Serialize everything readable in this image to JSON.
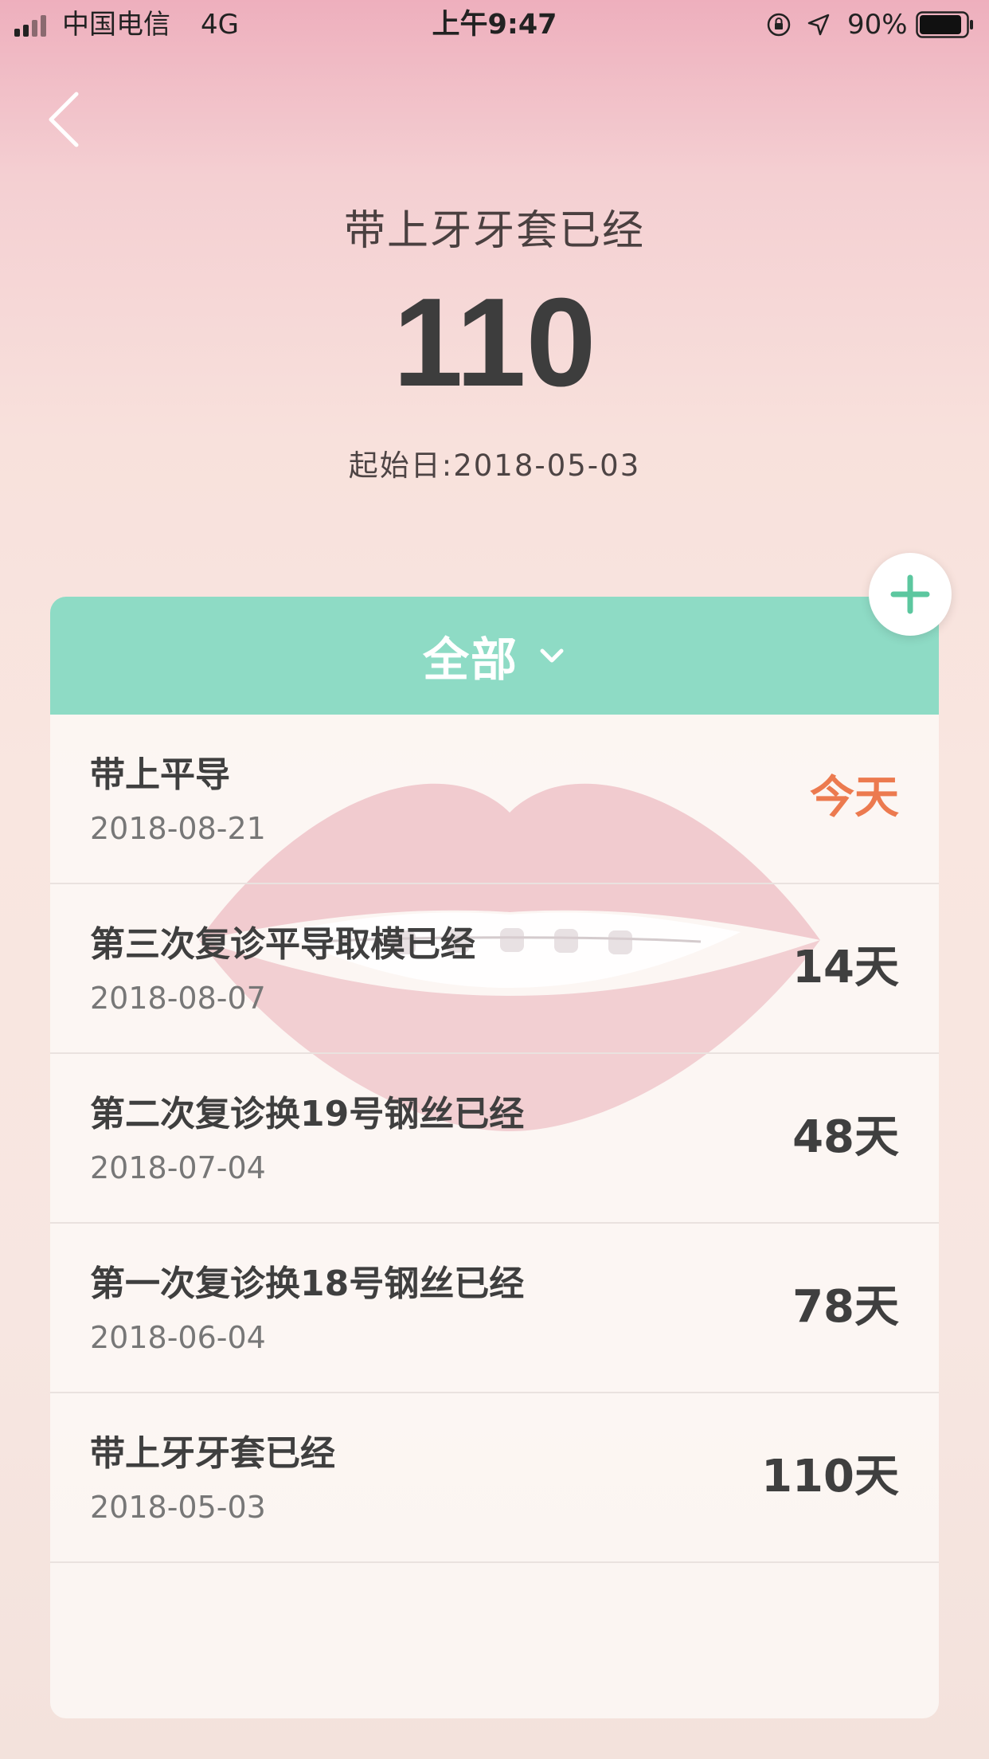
{
  "status_bar": {
    "carrier": "中国电信",
    "network": "4G",
    "time": "上午9:47",
    "battery": "90%",
    "battery_level": 0.9,
    "icons": [
      "signal-icon",
      "orientation-lock-icon",
      "location-icon",
      "battery-icon"
    ]
  },
  "nav": {
    "back_icon": "chevron-left-icon"
  },
  "header": {
    "title": "带上牙牙套已经",
    "days": "110",
    "start_date": "起始日:2018-05-03"
  },
  "filter": {
    "label": "全部",
    "icon": "chevron-down-icon"
  },
  "add_button": {
    "icon": "plus-icon"
  },
  "records": [
    {
      "title": "带上平导",
      "date": "2018-08-21",
      "days": "今天"
    },
    {
      "title": "第三次复诊平导取模已经",
      "date": "2018-08-07",
      "days": "14天"
    },
    {
      "title": "第二次复诊换19号钢丝已经",
      "date": "2018-07-04",
      "days": "48天"
    },
    {
      "title": "第一次复诊换18号钢丝已经",
      "date": "2018-06-04",
      "days": "78天"
    },
    {
      "title": "带上牙牙套已经",
      "date": "2018-05-03",
      "days": "110天"
    }
  ],
  "colors": {
    "accent_mint": "#8edbc5",
    "today_orange": "#ec7a4f",
    "plus_green": "#5cc79f",
    "text_dark": "#3f3f3f"
  }
}
